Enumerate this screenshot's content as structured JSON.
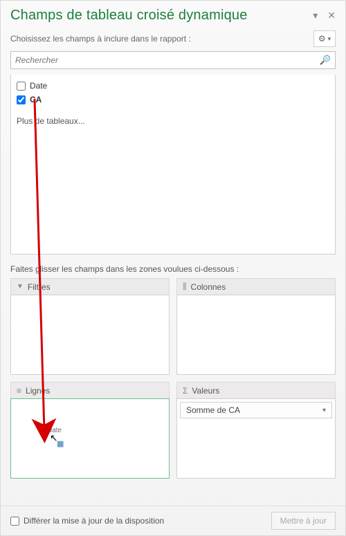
{
  "title": "Champs de tableau croisé dynamique",
  "instruction": "Choisissez les champs à inclure dans le rapport :",
  "search": {
    "placeholder": "Rechercher"
  },
  "fields": {
    "items": [
      {
        "label": "Date",
        "checked": false
      },
      {
        "label": "CA",
        "checked": true
      }
    ],
    "more": "Plus de tableaux..."
  },
  "drag_instruction": "Faites glisser les champs dans les zones voulues ci-dessous :",
  "areas": {
    "filters": {
      "label": "Filtres"
    },
    "columns": {
      "label": "Colonnes"
    },
    "rows": {
      "label": "Lignes"
    },
    "values": {
      "label": "Valeurs",
      "items": [
        {
          "label": "Somme de CA"
        }
      ]
    }
  },
  "drag_ghost": "Date",
  "defer": {
    "label": "Différer la mise à jour de la disposition",
    "checked": false
  },
  "update_button": "Mettre à jour",
  "icons": {
    "filter": "▼",
    "columns": "⫼",
    "rows": "≡",
    "values": "Σ",
    "gear": "⚙",
    "caret": "▾",
    "close": "✕",
    "dropdown": "▾",
    "search": "🔍"
  },
  "colors": {
    "accent_green": "#1a7f3a",
    "arrow_red": "#d40000"
  }
}
